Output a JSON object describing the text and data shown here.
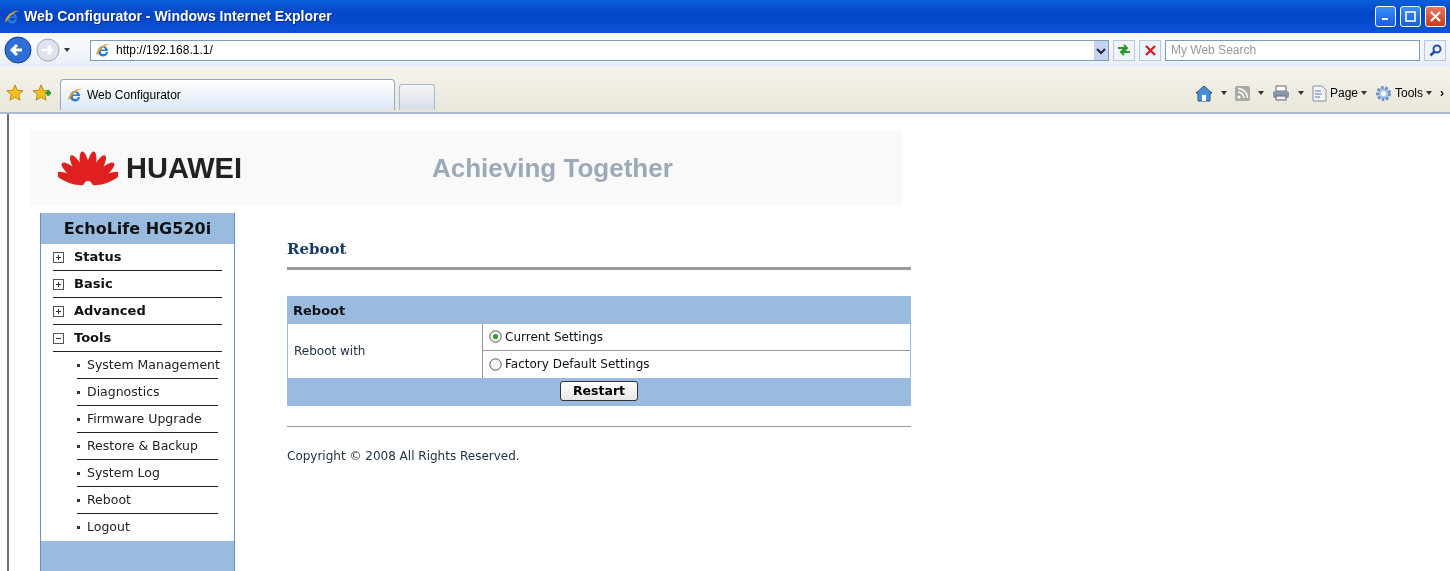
{
  "window": {
    "title": "Web Configurator - Windows Internet Explorer"
  },
  "address_bar": {
    "value": "http://192.168.1.1/"
  },
  "search": {
    "placeholder": "My Web Search"
  },
  "tabs": [
    {
      "label": "Web Configurator",
      "selected": true
    }
  ],
  "command_bar": {
    "items": [
      {
        "kind": "home"
      },
      {
        "kind": "feeds"
      },
      {
        "kind": "print"
      },
      {
        "kind": "page",
        "label": "Page"
      },
      {
        "kind": "tools",
        "label": "Tools"
      }
    ],
    "more": "›"
  },
  "page": {
    "logo": {
      "text": "HUAWEI"
    },
    "slogan": "Achieving Together",
    "sidebar": {
      "title": "EchoLife HG520i",
      "items": [
        {
          "label": "Status",
          "expanded": false
        },
        {
          "label": "Basic",
          "expanded": false
        },
        {
          "label": "Advanced",
          "expanded": false
        },
        {
          "label": "Tools",
          "expanded": true,
          "children": [
            {
              "label": "System Management"
            },
            {
              "label": "Diagnostics"
            },
            {
              "label": "Firmware Upgrade"
            },
            {
              "label": "Restore & Backup"
            },
            {
              "label": "System Log"
            },
            {
              "label": "Reboot"
            },
            {
              "label": "Logout"
            }
          ]
        }
      ]
    },
    "heading": "Reboot",
    "panel": {
      "title": "Reboot",
      "field_label": "Reboot with",
      "options": [
        {
          "label": "Current Settings",
          "selected": true
        },
        {
          "label": "Factory Default Settings",
          "selected": false
        }
      ],
      "button": "Restart"
    },
    "copyright": "Copyright © 2008 All Rights Reserved."
  }
}
